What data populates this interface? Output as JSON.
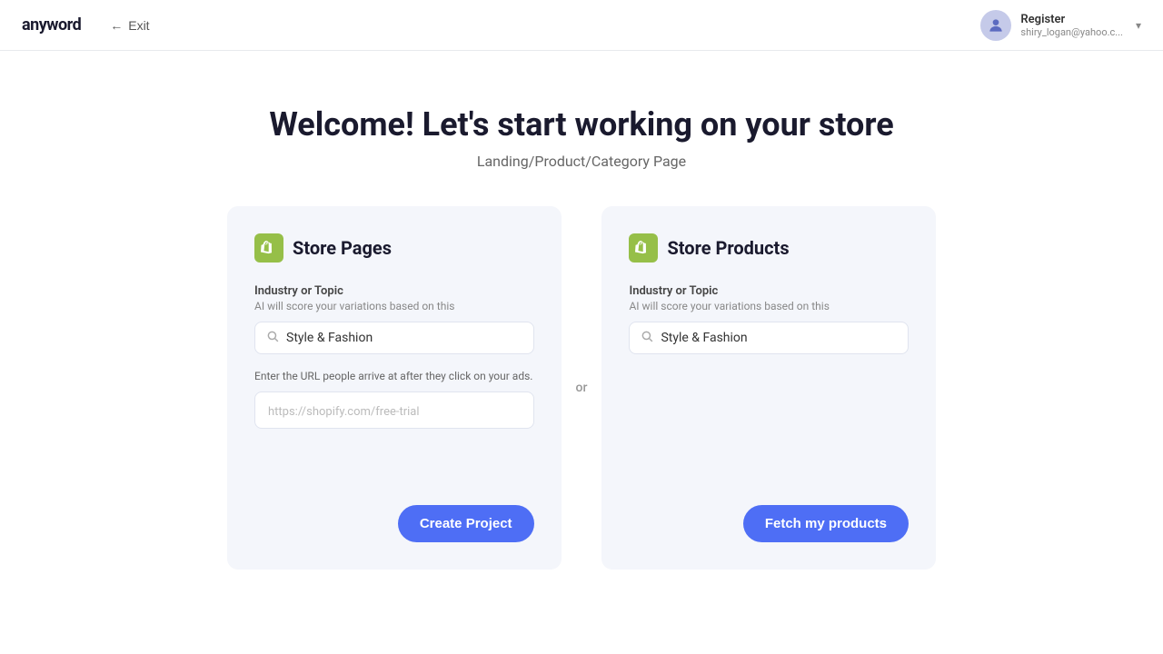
{
  "header": {
    "logo": "anyword",
    "exit_label": "Exit",
    "user": {
      "name": "Register",
      "email": "shiry_logan@yahoo.c..."
    }
  },
  "main": {
    "title": "Welcome! Let's start working on your store",
    "subtitle": "Landing/Product/Category Page",
    "or_label": "or"
  },
  "store_pages_card": {
    "title": "Store Pages",
    "field_label": "Industry or Topic",
    "field_sublabel": "AI will score your variations based on this",
    "search_value": "Style & Fashion",
    "url_label": "Enter the URL people arrive at after they click on your ads.",
    "url_placeholder": "https://shopify.com/free-trial",
    "button_label": "Create Project"
  },
  "store_products_card": {
    "title": "Store Products",
    "field_label": "Industry or Topic",
    "field_sublabel": "AI will score your variations based on this",
    "search_value": "Style & Fashion",
    "button_label": "Fetch my products"
  },
  "icons": {
    "shopify": "S",
    "search": "🔍",
    "arrow_left": "←",
    "chevron_down": "▾"
  }
}
